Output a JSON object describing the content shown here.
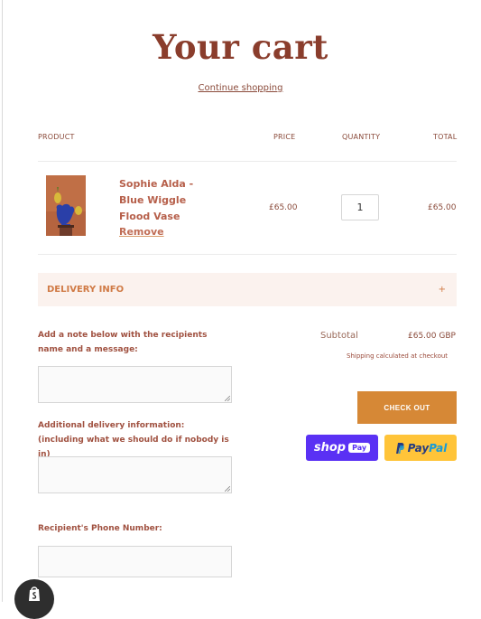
{
  "page": {
    "title": "Your cart",
    "continue_label": "Continue shopping"
  },
  "table": {
    "headers": {
      "product": "PRODUCT",
      "price": "PRICE",
      "quantity": "QUANTITY",
      "total": "TOTAL"
    }
  },
  "item": {
    "name_lines": [
      "Sophie Alda -",
      "Blue Wiggle",
      "Flood Vase"
    ],
    "remove_label": "Remove",
    "price": "£65.00",
    "quantity": "1",
    "total": "£65.00"
  },
  "delivery": {
    "label": "DELIVERY INFO",
    "toggle": "+"
  },
  "form": {
    "note_label": "Add a note below with the recipients name and a message:",
    "delivery_label": "Additional delivery information: (including what we should do if nobody is in)",
    "phone_label": "Recipient's Phone Number:"
  },
  "summary": {
    "subtotal_label": "Subtotal",
    "subtotal_value": "£65.00 GBP",
    "shipping_note": "Shipping calculated at checkout",
    "checkout_label": "CHECK OUT"
  },
  "payments": {
    "shoppay_shop": "shop",
    "shoppay_pay": "Pay",
    "paypal_pay": "Pay",
    "paypal_pal": "Pal"
  },
  "colors": {
    "accent": "#d68836",
    "title": "#8a3d2c",
    "delivery_bg": "#fbf2ee",
    "shoppay": "#5a31f4",
    "paypal": "#ffc439"
  },
  "icons": {
    "shopify_badge": "shopify-bag-icon",
    "paypal_glyph": "paypal-p-icon",
    "textarea_grip": "resize-grip-icon"
  }
}
